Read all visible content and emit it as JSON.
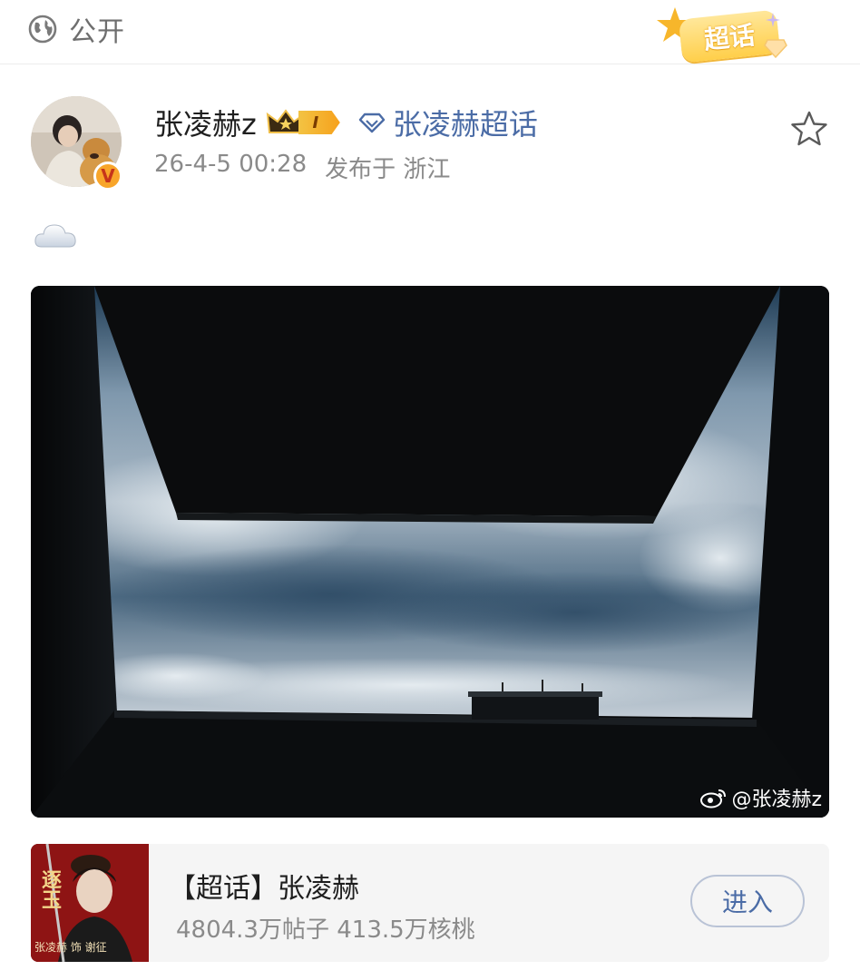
{
  "header": {
    "visibility_label": "公开",
    "visibility_icon": "globe-icon",
    "super_topic_badge": "超话"
  },
  "post": {
    "author": "张凌赫z",
    "level_badge": "I",
    "topic_link": "张凌赫超话",
    "timestamp": "26-4-5 00:28",
    "location": "发布于 浙江",
    "content_emoji": "cloud-emoji",
    "image_watermark": "@张凌赫z"
  },
  "topic_card": {
    "title": "【超话】张凌赫",
    "stats": "4804.3万帖子 413.5万核桃",
    "enter_label": "进入",
    "thumb_text_left": "逐玉",
    "thumb_text_bottom": "张凌赫 饰 谢征"
  },
  "colors": {
    "link_blue": "#4b6ca6",
    "meta_gray": "#8a8a8a",
    "badge_gold": "#ffcf4a"
  }
}
